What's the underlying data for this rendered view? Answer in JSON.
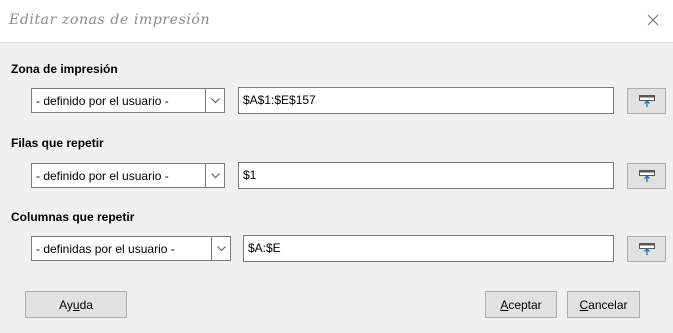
{
  "dialog": {
    "title": "Editar zonas de impresión"
  },
  "print_range": {
    "label": "Zona de impresión",
    "mode": "- definido por el usuario -",
    "value": "$A$1:$E$157"
  },
  "rows_repeat": {
    "label": "Filas que repetir",
    "mode": "- definido por el usuario -",
    "value": "$1"
  },
  "columns_repeat": {
    "label": "Columnas que repetir",
    "mode": "- definidas por el usuario -",
    "value": "$A:$E"
  },
  "buttons": {
    "help": {
      "pre": "Ay",
      "accel": "u",
      "post": "da"
    },
    "ok": {
      "pre": "",
      "accel": "A",
      "post": "ceptar"
    },
    "cancel": {
      "pre": "",
      "accel": "C",
      "post": "ancelar"
    }
  }
}
